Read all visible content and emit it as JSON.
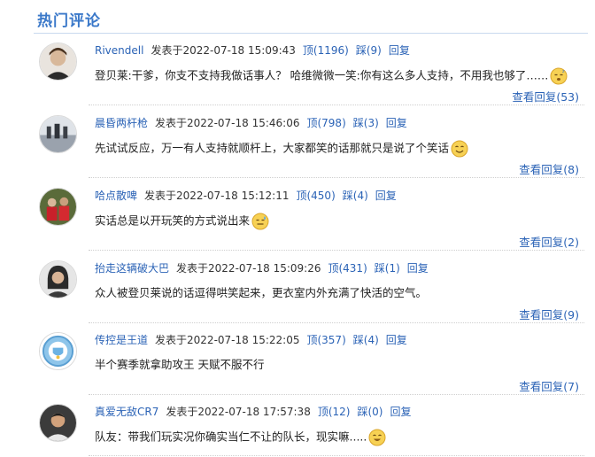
{
  "section": {
    "title": "热门评论"
  },
  "labels": {
    "posted": "发表于",
    "reply": "回复"
  },
  "comments": [
    {
      "user": "Rivendell",
      "time": "2022-07-18 15:09:43",
      "up": "顶(1196)",
      "down": "踩(9)",
      "text": "登贝莱:干爹，你支不支持我做话事人？ 哈维微微一笑:你有这么多人支持，不用我也够了……",
      "emoji": "sleepy-emoji-icon",
      "view_replies": "查看回复(53)"
    },
    {
      "user": "晨昏两杆枪",
      "time": "2022-07-18 15:46:06",
      "up": "顶(798)",
      "down": "踩(3)",
      "text": "先试试反应，万一有人支持就顺杆上，大家都笑的话那就只是说了个笑话",
      "emoji": "smile-emoji-icon",
      "view_replies": "查看回复(8)"
    },
    {
      "user": "哈点散啤",
      "time": "2022-07-18 15:12:11",
      "up": "顶(450)",
      "down": "踩(4)",
      "text": "实话总是以开玩笑的方式说出来",
      "emoji": "sweat-emoji-icon",
      "view_replies": "查看回复(2)"
    },
    {
      "user": "抬走这辆破大巴",
      "time": "2022-07-18 15:09:26",
      "up": "顶(431)",
      "down": "踩(1)",
      "text": "众人被登贝莱说的话逗得哄笑起来，更衣室内外充满了快活的空气。",
      "emoji": "",
      "view_replies": "查看回复(9)"
    },
    {
      "user": "传控是王道",
      "time": "2022-07-18 15:22:05",
      "up": "顶(357)",
      "down": "踩(4)",
      "text": "半个赛季就拿助攻王 天赋不服不行",
      "emoji": "",
      "view_replies": "查看回复(7)"
    },
    {
      "user": "真爱无敌CR7",
      "time": "2022-07-18 17:57:38",
      "up": "顶(12)",
      "down": "踩(0)",
      "text": "队友：带我们玩实况你确实当仁不让的队长，现实嘛.....",
      "emoji": "grin-emoji-icon",
      "view_replies": ""
    }
  ]
}
